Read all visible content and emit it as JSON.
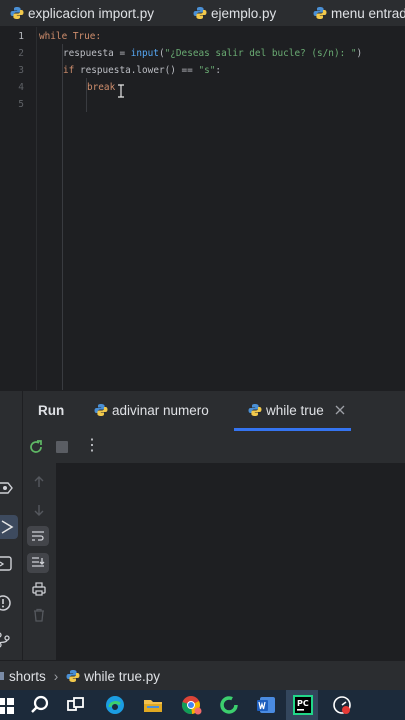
{
  "editor_tabs": [
    {
      "label": "explicacion import.py"
    },
    {
      "label": "ejemplo.py"
    },
    {
      "label": "menu entrada"
    }
  ],
  "line_numbers": [
    "1",
    "2",
    "3",
    "4",
    "5"
  ],
  "code": {
    "line1": {
      "kw": "while",
      "rest": " True:"
    },
    "line2": {
      "var": "respuesta = ",
      "fn": "input",
      "open": "(",
      "str": "\"¿Deseas salir del bucle? (s/n): \"",
      "close": ")"
    },
    "line3": {
      "kw": "if",
      "mid": " respuesta.lower() == ",
      "str": "\"s\"",
      "end": ":"
    },
    "line4": {
      "kw": "break"
    }
  },
  "run_panel": {
    "title": "Run",
    "tabs": [
      {
        "label": "adivinar numero"
      },
      {
        "label": "while true"
      }
    ],
    "toolbar": {
      "more_label": "⋮"
    }
  },
  "breadcrumb": {
    "project": "shorts",
    "separator": "›",
    "file": "while true.py"
  },
  "colors": {
    "keyword": "#cf8e6d",
    "function": "#56a8f5",
    "string": "#6aab73",
    "background": "#1e1f22",
    "panel": "#2b2d30"
  },
  "taskbar_icons": [
    "windows-start-icon",
    "search-icon",
    "task-view-icon",
    "edge-icon",
    "file-explorer-icon",
    "chrome-icon",
    "app-green-ring-icon",
    "word-icon",
    "pycharm-icon",
    "app-red-icon"
  ]
}
